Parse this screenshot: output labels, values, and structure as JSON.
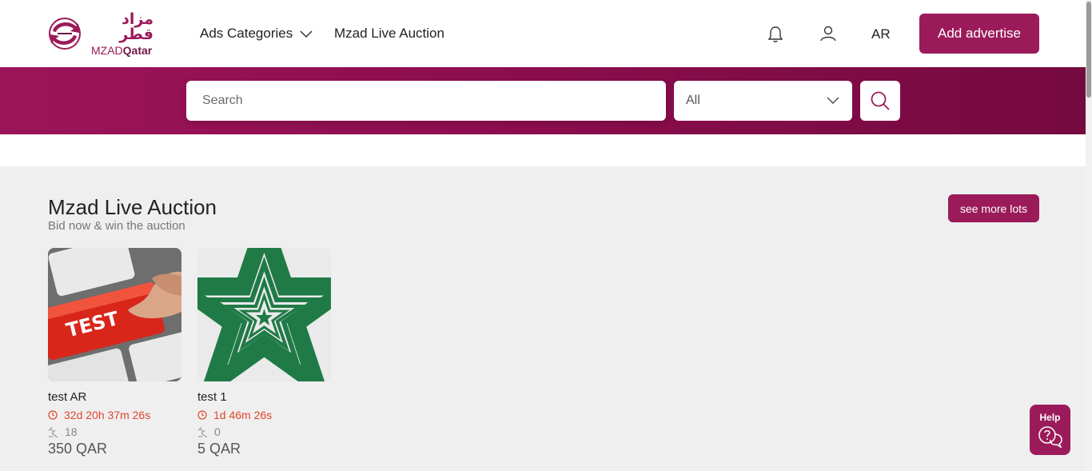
{
  "header": {
    "logo_ar": "مزاد قطر",
    "logo_en_light": "MZAD",
    "logo_en_bold": "Qatar",
    "nav_categories": "Ads Categories",
    "nav_live": "Mzad Live Auction",
    "lang": "AR",
    "add_button": "Add advertise",
    "icons": [
      "bell-icon",
      "user-icon"
    ]
  },
  "search": {
    "placeholder": "Search",
    "category_selected": "All"
  },
  "auction": {
    "title": "Mzad Live Auction",
    "subtitle": "Bid now & win the auction",
    "more_button": "see more lots",
    "items": [
      {
        "name": "test AR",
        "time_left": "32d 20h 37m 26s",
        "bids": "18",
        "price": "350 QAR",
        "image_text": "TEST"
      },
      {
        "name": "test 1",
        "time_left": "1d 46m 26s",
        "bids": "0",
        "price": "5 QAR"
      }
    ]
  },
  "help": {
    "label": "Help"
  },
  "colors": {
    "brand": "#9b1b5a",
    "band_start": "#9b1459",
    "band_end": "#740a40",
    "timer": "#e0462c",
    "section_bg": "#efefef"
  }
}
